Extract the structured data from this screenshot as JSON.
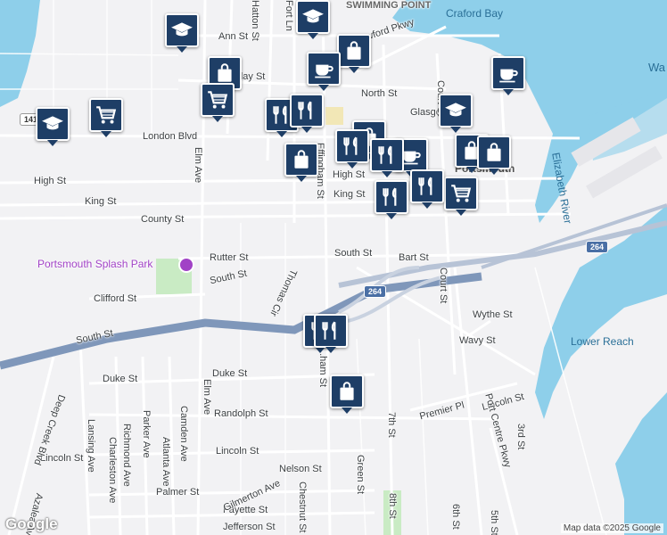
{
  "streets": {
    "ann": "Ann St",
    "crawford": "Crawford Pkwy",
    "north": "North St",
    "glasgow": "Glasgow St",
    "london": "London Blvd",
    "high_left": "High St",
    "high_center": "High St",
    "king_left": "King St",
    "king_center": "King St",
    "county": "County St",
    "rutter": "Rutter St",
    "south_w": "South St",
    "south_c": "South St",
    "south_far": "South St",
    "bart": "Bart St",
    "clifford": "Clifford St",
    "wythe": "Wythe St",
    "wavy": "Wavy St",
    "duke": "Duke St",
    "randolph": "Randolph St",
    "lincoln_w": "Lincoln St",
    "lincoln_c": "Lincoln St",
    "lincoln_e": "Lincoln St",
    "premier": "Premier Pl",
    "nelson": "Nelson St",
    "palmer": "Palmer St",
    "fayette": "Fayette St",
    "jefferson": "Jefferson St",
    "gilmerton": "Gilmerton Ave",
    "holiday": "...day St",
    "elm": "Elm Ave",
    "effingham": "Effingham St",
    "effingham_s": "...ham St",
    "court_n": "Court St",
    "court_s": "Court St",
    "port_centre": "Port Centre Pkwy",
    "thomas": "Thomas Cir",
    "hatton": "Hatton St",
    "fort": "Fort Ln",
    "deep_creek": "Deep Creek Blvd",
    "lansing": "Lansing Ave",
    "atlanta": "Atlanta Ave",
    "charleston": "Charleston Ave",
    "richmond": "Richmond Ave",
    "parker": "Parker Ave",
    "camden": "Camden Ave",
    "azalea": "Azalea Ave",
    "chestnut": "Chestnut St",
    "green": "Green St",
    "seventh": "7th St",
    "eighth": "8th St",
    "sixth": "6th St",
    "fifth": "5th St",
    "third": "3rd St",
    "seventh_n": "7th St",
    "sixth_n": "6th St"
  },
  "places": {
    "splash_park": "Portsmouth Splash Park",
    "crawford_bay": "Craford Bay",
    "elizabeth_river": "Elizabeth River",
    "lower_reach": "Lower Reach",
    "portsmouth": "Portsmouth",
    "swimming_point": "SWIMMING POINT",
    "wa": "Wa"
  },
  "highways": {
    "i264_w": "264",
    "i264_e": "264",
    "r141": "141"
  },
  "pins": [
    {
      "icon": "graduation-cap-icon"
    },
    {
      "icon": "graduation-cap-icon"
    },
    {
      "icon": "graduation-cap-icon"
    },
    {
      "icon": "graduation-cap-icon"
    },
    {
      "icon": "shopping-bag-icon"
    },
    {
      "icon": "shopping-bag-icon"
    },
    {
      "icon": "shopping-bag-icon"
    },
    {
      "icon": "shopping-bag-icon"
    },
    {
      "icon": "shopping-bag-icon"
    },
    {
      "icon": "shopping-bag-icon"
    },
    {
      "icon": "shopping-cart-icon"
    },
    {
      "icon": "shopping-cart-icon"
    },
    {
      "icon": "shopping-cart-icon"
    },
    {
      "icon": "coffee-cup-icon"
    },
    {
      "icon": "coffee-cup-icon"
    },
    {
      "icon": "coffee-cup-icon"
    },
    {
      "icon": "restaurant-icon"
    },
    {
      "icon": "restaurant-icon"
    },
    {
      "icon": "restaurant-icon"
    },
    {
      "icon": "restaurant-icon"
    },
    {
      "icon": "restaurant-icon"
    },
    {
      "icon": "restaurant-icon"
    },
    {
      "icon": "restaurant-icon"
    },
    {
      "icon": "restaurant-icon"
    }
  ],
  "attribution": "Map data ©2025 Google",
  "logo": "Google",
  "colors": {
    "water": "#8ecfea",
    "park": "#c9ebc4",
    "highway": "#8aa0c0",
    "pin": "#1e3e66"
  }
}
